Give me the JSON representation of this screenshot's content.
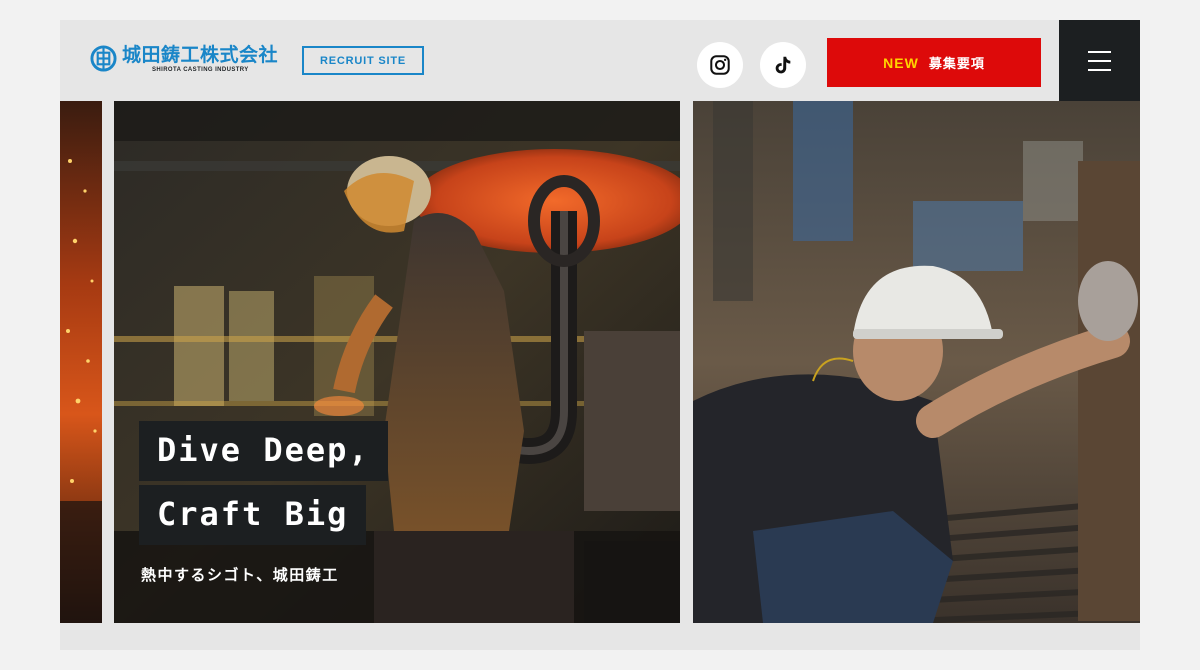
{
  "header": {
    "logo_name": "城田鋳工株式会社",
    "logo_sub": "SHIROTA CASTING INDUSTRY",
    "recruit_label": "RECRUIT SITE",
    "cta_new": "NEW",
    "cta_label": "募集要項",
    "social": [
      "instagram-icon",
      "tiktok-icon"
    ],
    "menu_icon": "hamburger-menu-icon"
  },
  "hero": {
    "headline_line1": "Dive Deep,",
    "headline_line2": "Craft Big",
    "subcopy": "熱中するシゴト、城田鋳工"
  },
  "colors": {
    "brand_blue": "#1a86c8",
    "cta_red": "#dd0a0a",
    "cta_new_yellow": "#ffd400",
    "dark": "#1c1f21",
    "frame_bg": "#e6e6e6",
    "page_bg": "#f2f2f2"
  }
}
